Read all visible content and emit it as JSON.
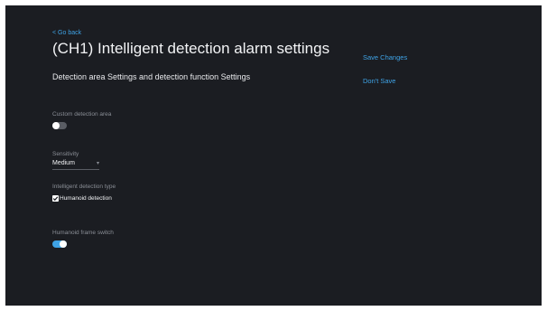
{
  "header": {
    "back_label": "< Go back",
    "title": "(CH1)  Intelligent detection alarm settings",
    "subtitle": "Detection area Settings and detection function Settings"
  },
  "actions": {
    "save_label": "Save Changes",
    "dont_save_label": "Don't Save"
  },
  "settings": {
    "custom_area": {
      "label": "Custom detection area",
      "enabled": false
    },
    "sensitivity": {
      "label": "Sensitivity",
      "value": "Medium"
    },
    "detection_type": {
      "label": "Intelligent detection type",
      "options": [
        {
          "label": "Humanoid detection",
          "checked": true
        }
      ]
    },
    "humanoid_frame": {
      "label": "Humanoid frame switch",
      "enabled": true
    }
  },
  "colors": {
    "background": "#1b1d22",
    "accent": "#3fa3e6",
    "muted_text": "#8a8e96"
  }
}
